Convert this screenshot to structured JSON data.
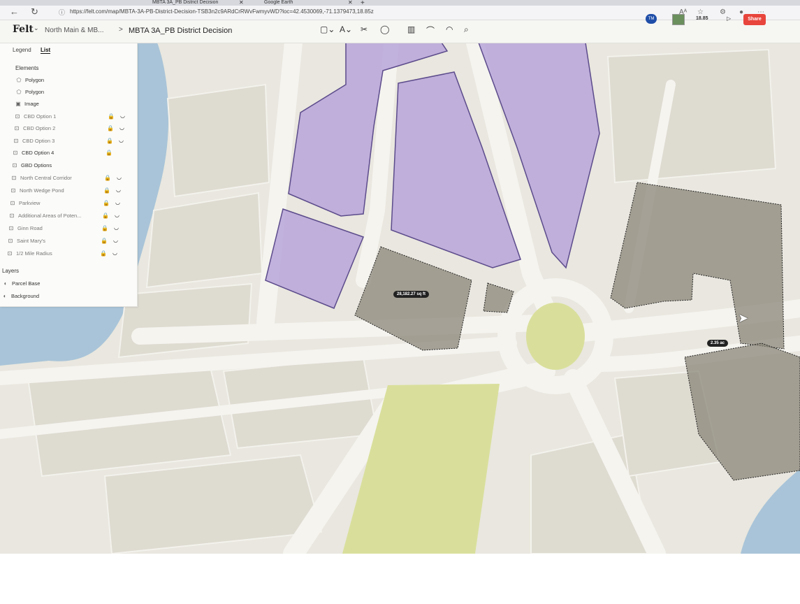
{
  "browser": {
    "tabs": [
      {
        "title": "MBTA 3A_PB District Decision"
      },
      {
        "title": "Google Earth"
      }
    ],
    "url": "https://felt.com/map/MBTA-3A-PB-District-Decision-TSB3n2c9ARdCrRWvFwmyvWD?loc=42.4530069,-71.1379473,18.85z"
  },
  "toolbar": {
    "logo": "Felt",
    "project": "North Main & MB...",
    "separator": ">",
    "map_title": "MBTA 3A_PB District Decision",
    "avatar_initials": "TM",
    "zoom": "18.85",
    "share_label": "Share"
  },
  "panel": {
    "tabs": [
      "Legend",
      "List"
    ],
    "active_tab": "List",
    "elements_heading": "Elements",
    "elements": [
      {
        "label": "Polygon",
        "icon": "polygon-icon",
        "locked": false
      },
      {
        "label": "Polygon",
        "icon": "polygon-icon",
        "locked": false
      },
      {
        "label": "Image",
        "icon": "image-icon",
        "locked": false
      },
      {
        "label": "CBD Option 1",
        "icon": "group-icon",
        "locked": true
      },
      {
        "label": "CBD Option 2",
        "icon": "group-icon",
        "locked": true
      },
      {
        "label": "CBD Option 3",
        "icon": "group-icon",
        "locked": true
      },
      {
        "label": "CBD Option 4",
        "icon": "group-icon",
        "locked": true
      },
      {
        "label": "GBD Options",
        "icon": "group-icon",
        "locked": false
      },
      {
        "label": "North Central Corridor",
        "icon": "group-icon",
        "locked": true
      },
      {
        "label": "North Wedge Pond",
        "icon": "group-icon",
        "locked": true
      },
      {
        "label": "Parkview",
        "icon": "group-icon",
        "locked": true
      },
      {
        "label": "Additional Areas of Poten...",
        "icon": "group-icon",
        "locked": true
      },
      {
        "label": "Ginn Road",
        "icon": "group-icon",
        "locked": true
      },
      {
        "label": "Saint Mary's",
        "icon": "group-icon",
        "locked": true
      },
      {
        "label": "1/2 Mile Radius",
        "icon": "group-icon",
        "locked": true
      }
    ],
    "layers_heading": "Layers",
    "layers": [
      {
        "label": "Parcel Base",
        "icon": "layer-icon"
      },
      {
        "label": "Background",
        "icon": "layer-icon"
      }
    ]
  },
  "map": {
    "labels": [
      {
        "text": "28,182.27 sq ft"
      },
      {
        "text": "2.35 ac"
      }
    ]
  },
  "colors": {
    "water": "#a9c4d8",
    "land": "#e9e7df",
    "road": "#f4f3ee",
    "purple_polygon": "#b7a4d9",
    "grey_selection": "#8a8578",
    "park": "#d9df9b",
    "share": "#e8453c"
  }
}
